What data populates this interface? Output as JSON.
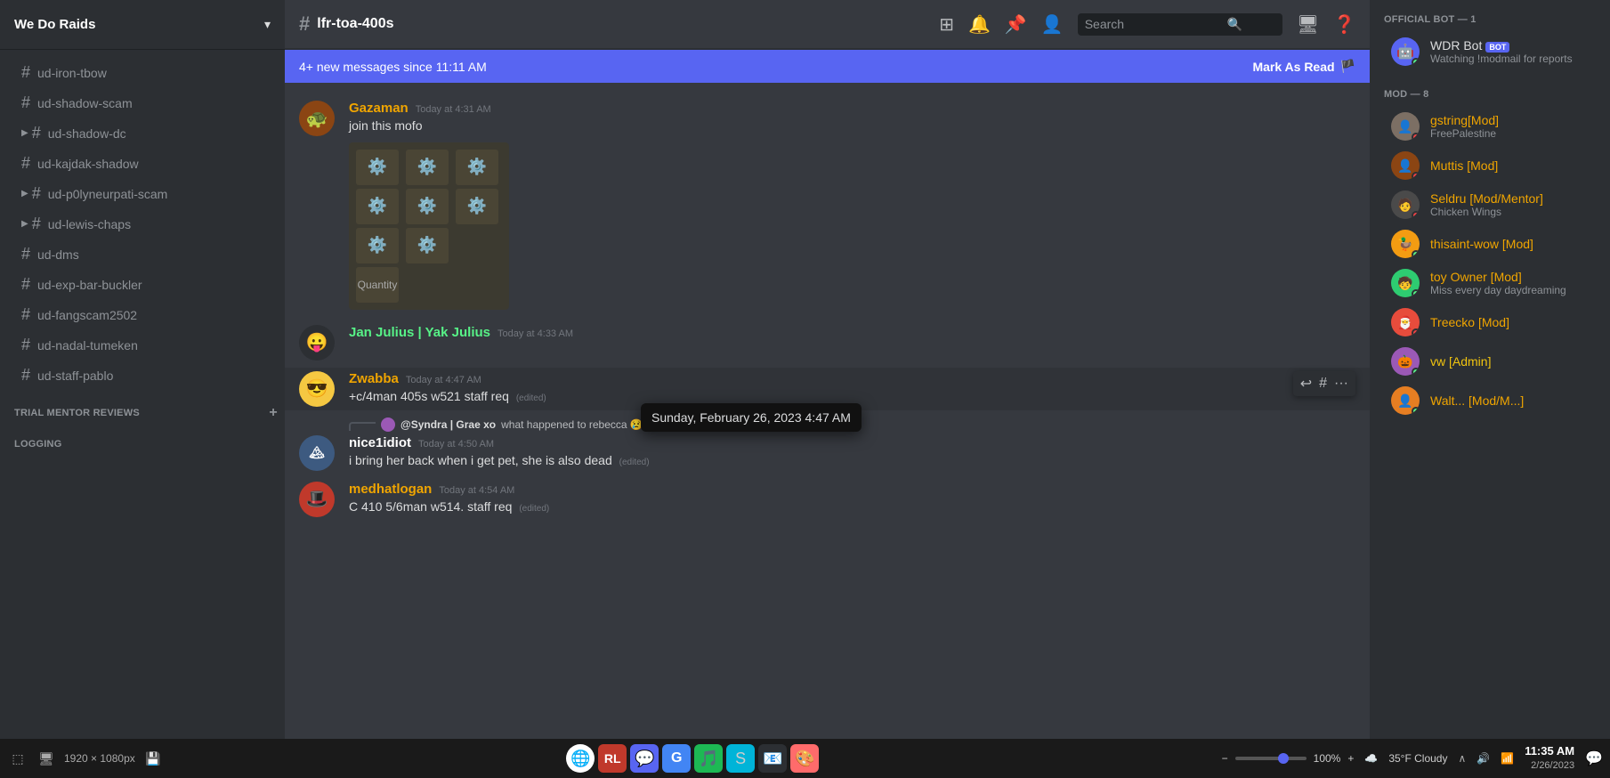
{
  "app": {
    "server_name": "We Do Raids",
    "channel_name": "lfr-toa-400s"
  },
  "sidebar": {
    "channels": [
      {
        "name": "ud-iron-tbow",
        "active": false
      },
      {
        "name": "ud-shadow-scam",
        "active": false
      },
      {
        "name": "ud-shadow-dc",
        "active": false,
        "arrow": true
      },
      {
        "name": "ud-kajdak-shadow",
        "active": false
      },
      {
        "name": "ud-p0lyneurpati-scam",
        "active": false,
        "arrow": true
      },
      {
        "name": "ud-lewis-chaps",
        "active": false,
        "arrow": true
      },
      {
        "name": "ud-dms",
        "active": false
      },
      {
        "name": "ud-exp-bar-buckler",
        "active": false
      },
      {
        "name": "ud-fangscam2502",
        "active": false
      },
      {
        "name": "ud-nadal-tumeken",
        "active": false
      },
      {
        "name": "ud-staff-pablo",
        "active": false
      }
    ],
    "sections": [
      {
        "name": "TRIAL MENTOR REVIEWS",
        "collapsed": true
      },
      {
        "name": "LOGGING",
        "collapsed": true
      }
    ]
  },
  "banner": {
    "text": "4+ new messages since 11:11 AM",
    "action": "Mark As Read"
  },
  "messages": [
    {
      "id": "msg1",
      "username": "Gazaman",
      "username_color": "gold",
      "timestamp": "Today at 4:31 AM",
      "text": "join this mofo",
      "has_attachment": true
    },
    {
      "id": "msg2",
      "username": "Jan Julius | Yak Julius",
      "username_color": "green",
      "timestamp": "Today at 4:33 AM",
      "text": "",
      "has_attachment": false
    },
    {
      "id": "msg3",
      "username": "Zwabba",
      "username_color": "gold",
      "timestamp": "Today at 4:47 AM",
      "text": "+c/4man 405s w521 staff req",
      "edited": true,
      "show_actions": true
    },
    {
      "id": "msg4",
      "username": "nice1idiot",
      "username_color": "white",
      "timestamp": "Today at 4:50 AM",
      "text": "i bring her back when i get pet, she is also dead",
      "edited": true,
      "has_reply": true,
      "reply_user": "Syndra | Grae xo",
      "reply_text": "what happened to rebecca 😢"
    },
    {
      "id": "msg5",
      "username": "medhatlogan",
      "username_color": "gold",
      "timestamp": "Today at 4:54 AM",
      "text": "C 410 5/6man w514. staff req",
      "edited": true
    }
  ],
  "tooltip": {
    "text": "Sunday, February 26, 2023 4:47 AM"
  },
  "members": {
    "sections": [
      {
        "title": "OFFICIAL BOT — 1",
        "members": [
          {
            "name": "WDR Bot",
            "is_bot": true,
            "status": "online",
            "activity": "Watching !modmail for reports",
            "color": "default"
          }
        ]
      },
      {
        "title": "MOD — 8",
        "members": [
          {
            "name": "gstring[Mod]",
            "status": "dnd",
            "activity": "FreePalestine",
            "color": "mod"
          },
          {
            "name": "Muttis [Mod]",
            "status": "dnd",
            "activity": "",
            "color": "mod"
          },
          {
            "name": "Seldru [Mod/Mentor]",
            "status": "dnd",
            "activity": "Chicken Wings",
            "color": "mod"
          },
          {
            "name": "thisaint-wow [Mod]",
            "status": "online",
            "activity": "",
            "color": "mod"
          },
          {
            "name": "toy Owner [Mod]",
            "status": "online",
            "activity": "Miss every day daydreaming",
            "color": "mod"
          },
          {
            "name": "Treecko [Mod]",
            "status": "dnd",
            "activity": "",
            "color": "mod"
          },
          {
            "name": "vw [Admin]",
            "status": "online",
            "activity": "",
            "color": "admin"
          },
          {
            "name": "Walt... [Mod/M...]",
            "status": "online",
            "activity": "",
            "color": "mod"
          }
        ]
      }
    ]
  },
  "search": {
    "placeholder": "Search"
  },
  "taskbar": {
    "resolution": "1920 × 1080px",
    "zoom": "100%",
    "weather": "35°F  Cloudy",
    "time": "11:35 AM",
    "date": "2/26/2023"
  }
}
